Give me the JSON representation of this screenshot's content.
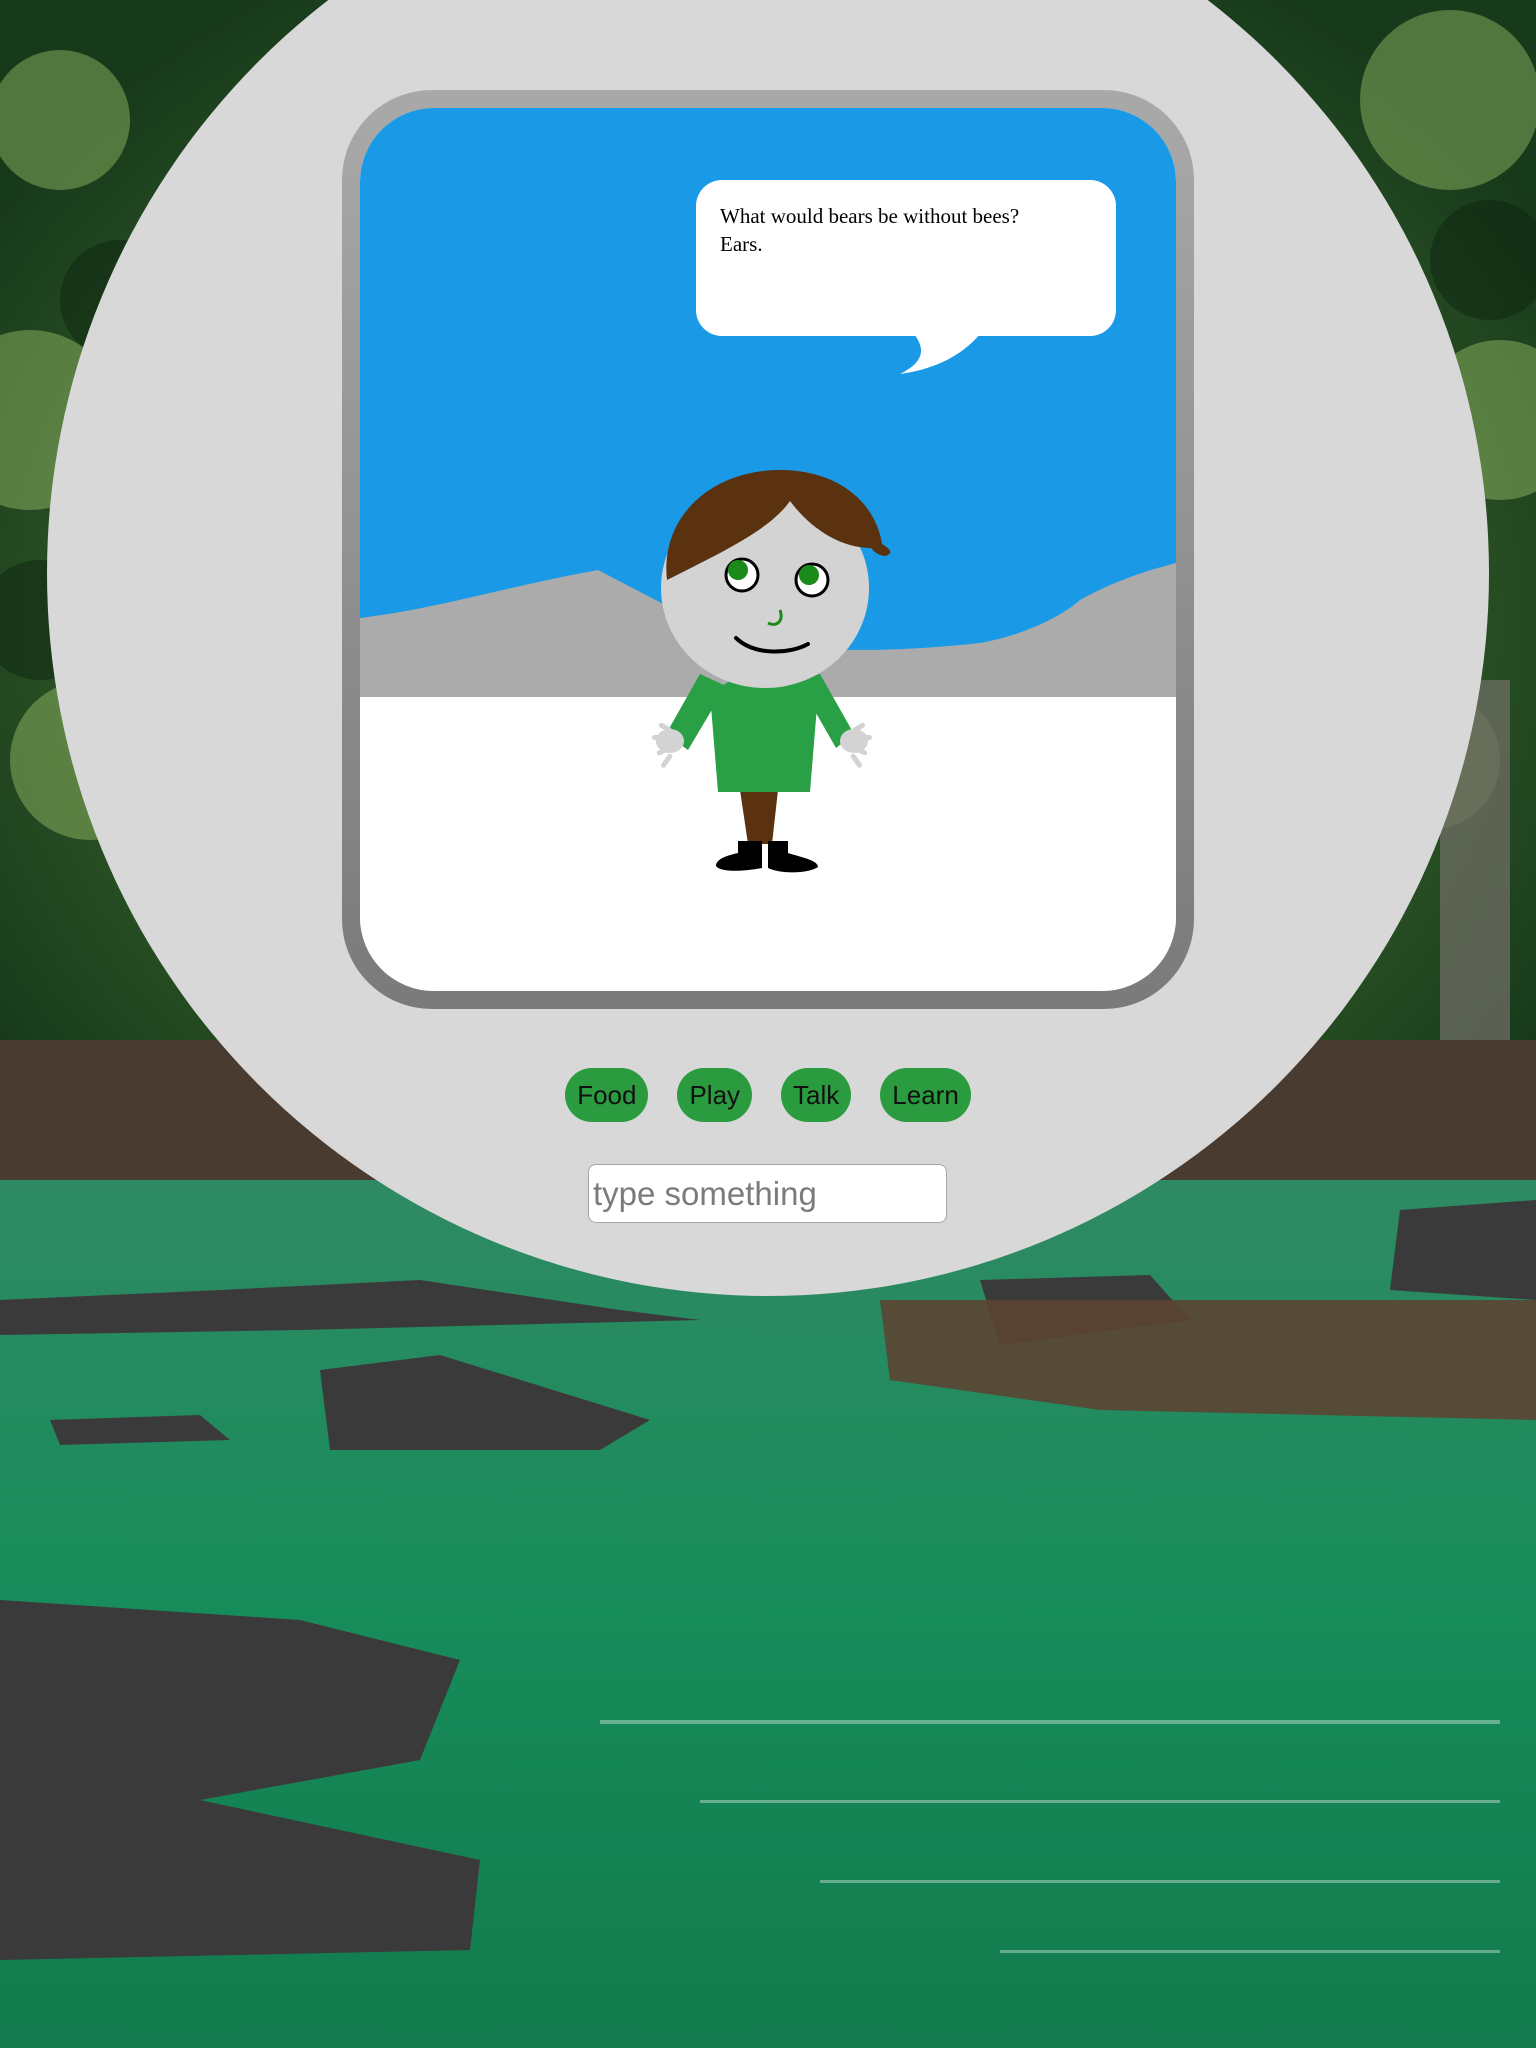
{
  "background": {
    "description_icon": "river-forest-photo-icon"
  },
  "pet": {
    "speech": {
      "line1": "What would bears be without bees?",
      "line2": "Ears."
    }
  },
  "actions": [
    {
      "label": "Food"
    },
    {
      "label": "Play"
    },
    {
      "label": "Talk"
    },
    {
      "label": "Learn"
    }
  ],
  "input": {
    "value": "",
    "placeholder": "type something"
  },
  "colors": {
    "sky": "#1a9ae6",
    "mountains": "#ababab",
    "ground": "#ffffff",
    "device": "#d8d8d8",
    "button": "#2a9b3f",
    "shirt": "#2aa046",
    "hair": "#5a320f",
    "eyes": "#1a8a1a"
  }
}
